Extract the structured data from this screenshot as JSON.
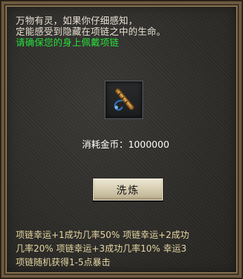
{
  "description": {
    "line1": "万物有灵，如果你仔细感知，",
    "line2": "定能感受到隐藏在项链之中的生命。",
    "notice": "请确保您的身上佩戴项链"
  },
  "item_slot": {
    "icon": "necklace-icon"
  },
  "cost": {
    "label": "消耗金币：",
    "amount": "1000000"
  },
  "refine_button": {
    "label": "洗炼"
  },
  "info": {
    "line1": "项链幸运+1成功几率50%  项链幸运+2成功",
    "line2": "几率20%  项链幸运+3成功几率10%  幸运3",
    "line3": "项链随机获得1-5点暴击"
  },
  "colors": {
    "notice_green": "#27e03a",
    "info_gold": "#e6d7a2",
    "panel_bg": "#2d2c29",
    "frame": "#6d5a40"
  }
}
